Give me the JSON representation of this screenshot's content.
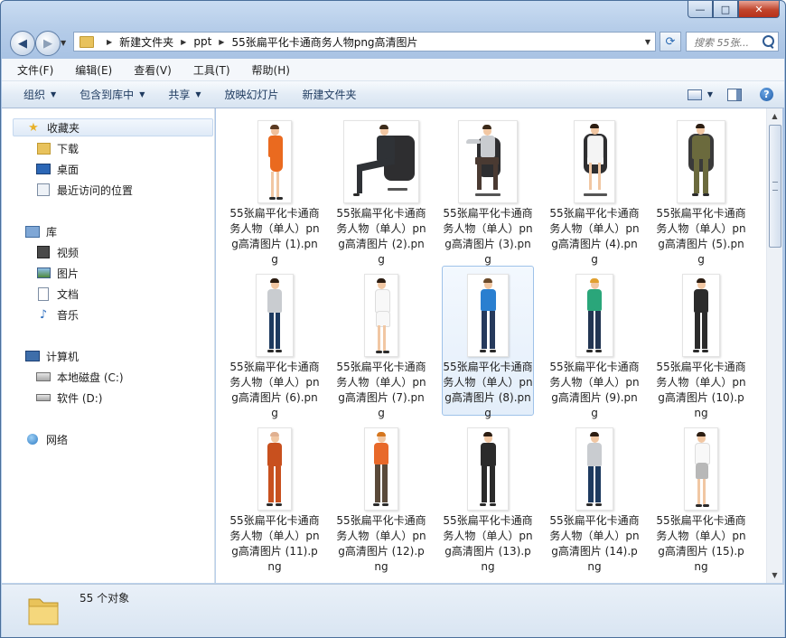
{
  "window": {
    "caption_buttons": {
      "minimize": "—",
      "maximize": "□",
      "close": "✕"
    }
  },
  "nav": {
    "back_label": "◀",
    "forward_label": "▶",
    "breadcrumbs": [
      "新建文件夹",
      "ppt",
      "55张扁平化卡通商务人物png高清图片"
    ],
    "search_placeholder": "搜索 55张..."
  },
  "menu": [
    "文件(F)",
    "编辑(E)",
    "查看(V)",
    "工具(T)",
    "帮助(H)"
  ],
  "commands": [
    "组织",
    "包含到库中",
    "共享",
    "放映幻灯片",
    "新建文件夹"
  ],
  "sidebar": {
    "favorites": {
      "label": "收藏夹",
      "items": [
        "下载",
        "桌面",
        "最近访问的位置"
      ]
    },
    "libraries": {
      "label": "库",
      "items": [
        "视频",
        "图片",
        "文档",
        "音乐"
      ]
    },
    "computer": {
      "label": "计算机",
      "items": [
        "本地磁盘 (C:)",
        "软件 (D:)"
      ]
    },
    "network": {
      "label": "网络"
    }
  },
  "files": [
    {
      "name": "55张扁平化卡通商务人物（单人）png高清图片 (1).png",
      "selected": false
    },
    {
      "name": "55张扁平化卡通商务人物（单人）png高清图片 (2).png",
      "selected": false
    },
    {
      "name": "55张扁平化卡通商务人物（单人）png高清图片 (3).png",
      "selected": false
    },
    {
      "name": "55张扁平化卡通商务人物（单人）png高清图片 (4).png",
      "selected": false
    },
    {
      "name": "55张扁平化卡通商务人物（单人）png高清图片 (5).png",
      "selected": false
    },
    {
      "name": "55张扁平化卡通商务人物（单人）png高清图片 (6).png",
      "selected": false
    },
    {
      "name": "55张扁平化卡通商务人物（单人）png高清图片 (7).png",
      "selected": false
    },
    {
      "name": "55张扁平化卡通商务人物（单人）png高清图片 (8).png",
      "selected": true
    },
    {
      "name": "55张扁平化卡通商务人物（单人）png高清图片 (9).png",
      "selected": false
    },
    {
      "name": "55张扁平化卡通商务人物（单人）png高清图片 (10).png",
      "selected": false
    },
    {
      "name": "55张扁平化卡通商务人物（单人）png高清图片 (11).png",
      "selected": false
    },
    {
      "name": "55张扁平化卡通商务人物（单人）png高清图片 (12).png",
      "selected": false
    },
    {
      "name": "55张扁平化卡通商务人物（单人）png高清图片 (13).png",
      "selected": false
    },
    {
      "name": "55张扁平化卡通商务人物（单人）png高清图片 (14).png",
      "selected": false
    },
    {
      "name": "55张扁平化卡通商务人物（单人）png高清图片 (15).png",
      "selected": false
    }
  ],
  "status": {
    "count": "55 个对象"
  }
}
